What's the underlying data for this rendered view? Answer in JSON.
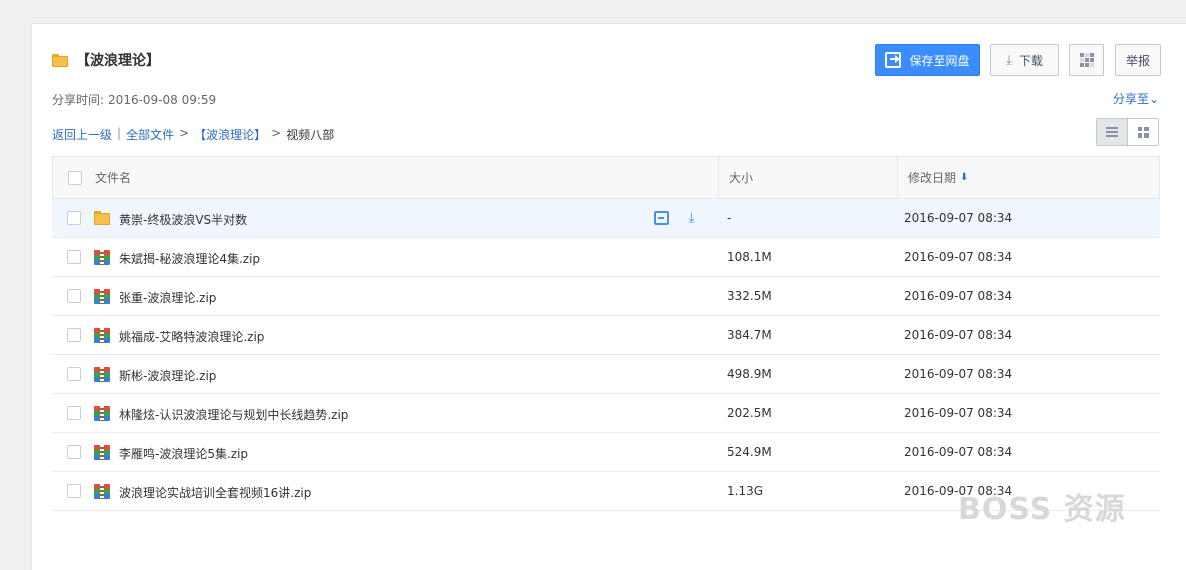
{
  "header": {
    "title": "【波浪理论】",
    "share_time_label": "分享时间:",
    "share_time_value": "2016-09-08 09:59",
    "share_to": "分享至⌄"
  },
  "actions": {
    "save_label": "保存至网盘",
    "download_label": "下载",
    "report_label": "举报"
  },
  "breadcrumb": {
    "back": "返回上一级",
    "sep": "|",
    "all_files": "全部文件",
    "folder": "【波浪理论】",
    "current": "视频八部",
    "gt": ">"
  },
  "table": {
    "headers": {
      "name": "文件名",
      "size": "大小",
      "date": "修改日期"
    },
    "rows": [
      {
        "name": "黄崇-终极波浪VS半对数",
        "size": "-",
        "date": "2016-09-07 08:34",
        "type": "folder"
      },
      {
        "name": "朱斌揭-秘波浪理论4集.zip",
        "size": "108.1M",
        "date": "2016-09-07 08:34",
        "type": "zip"
      },
      {
        "name": "张重-波浪理论.zip",
        "size": "332.5M",
        "date": "2016-09-07 08:34",
        "type": "zip"
      },
      {
        "name": "姚福成-艾略特波浪理论.zip",
        "size": "384.7M",
        "date": "2016-09-07 08:34",
        "type": "zip"
      },
      {
        "name": "斯彬-波浪理论.zip",
        "size": "498.9M",
        "date": "2016-09-07 08:34",
        "type": "zip"
      },
      {
        "name": "林隆炫-认识波浪理论与规划中长线趋势.zip",
        "size": "202.5M",
        "date": "2016-09-07 08:34",
        "type": "zip"
      },
      {
        "name": "李雁鸣-波浪理论5集.zip",
        "size": "524.9M",
        "date": "2016-09-07 08:34",
        "type": "zip"
      },
      {
        "name": "波浪理论实战培训全套视频16讲.zip",
        "size": "1.13G",
        "date": "2016-09-07 08:34",
        "type": "zip"
      }
    ]
  },
  "watermark": "BOSS 资源"
}
